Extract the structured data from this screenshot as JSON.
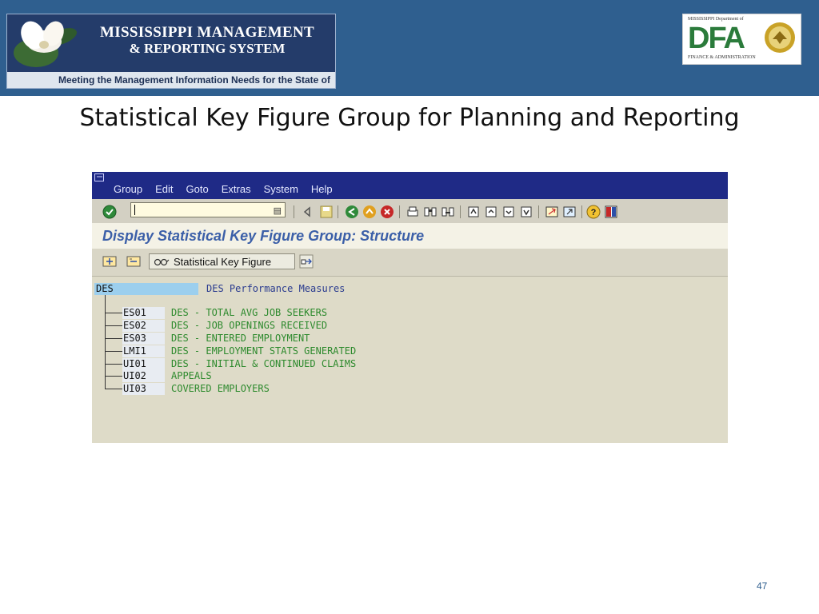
{
  "header": {
    "mmrs_line1": "MISSISSIPPI MANAGEMENT",
    "mmrs_line2": "& REPORTING SYSTEM",
    "mmrs_tagline": "Meeting the Management Information Needs for the State of Mississippi",
    "dfa_top": "MISSISSIPPI Department of",
    "dfa_letters": "DFA",
    "dfa_bottom": "FINANCE & ADMINISTRATION"
  },
  "slide_title": "Statistical Key Figure Group for Planning and Reporting",
  "sap": {
    "menu": [
      "Group",
      "Edit",
      "Goto",
      "Extras",
      "System",
      "Help"
    ],
    "screen_title": "Display Statistical Key Figure Group: Structure",
    "app_toolbar": {
      "skf_button": "Statistical Key Figure"
    },
    "tree": {
      "root_code": "DES",
      "root_desc": "DES Performance Measures",
      "items": [
        {
          "code": "ES01",
          "desc": "DES - TOTAL AVG JOB SEEKERS"
        },
        {
          "code": "ES02",
          "desc": "DES - JOB OPENINGS RECEIVED"
        },
        {
          "code": "ES03",
          "desc": "DES - ENTERED EMPLOYMENT"
        },
        {
          "code": "LMI1",
          "desc": "DES - EMPLOYMENT STATS GENERATED"
        },
        {
          "code": "UI01",
          "desc": "DES - INITIAL & CONTINUED CLAIMS"
        },
        {
          "code": "UI02",
          "desc": "APPEALS"
        },
        {
          "code": "UI03",
          "desc": "COVERED EMPLOYERS"
        }
      ]
    }
  },
  "page_number": "47"
}
